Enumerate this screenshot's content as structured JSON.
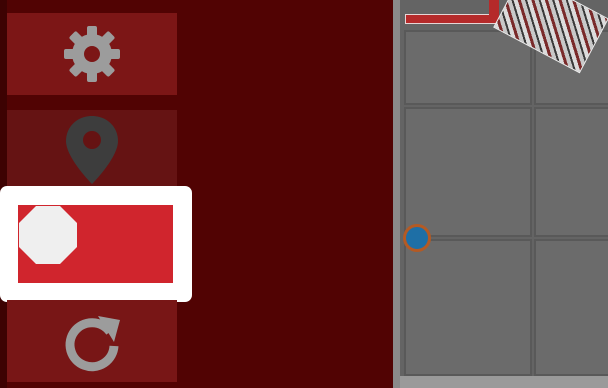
{
  "controls": {
    "settings": {
      "icon": "gear-icon",
      "color": "#7c1616"
    },
    "location": {
      "icon": "map-pin-icon",
      "color": "#651313"
    },
    "stop": {
      "icon": "stop-octagon-icon",
      "color": "#d0252d",
      "selected": true
    },
    "reset": {
      "icon": "reset-arrow-icon",
      "color": "#781616"
    }
  },
  "scene": {
    "background_color": "#510303",
    "field_color": "#646464",
    "wall_color": "#b52a2a",
    "ball_color": "#1e6fa6",
    "ball_ring_color": "#b45a24"
  }
}
